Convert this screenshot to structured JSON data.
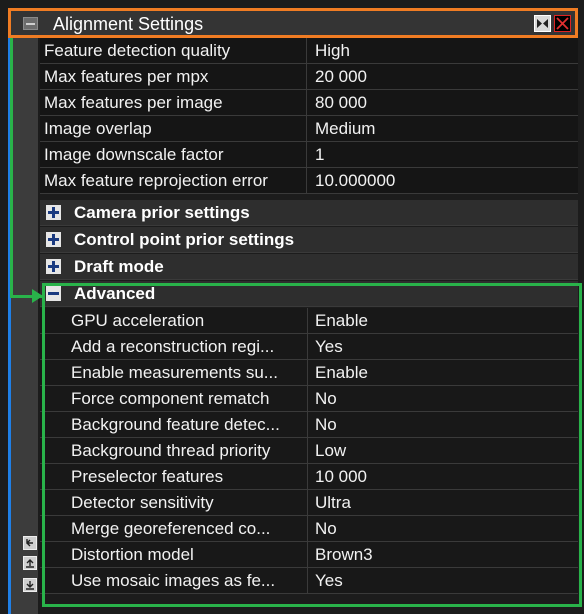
{
  "title_bar": {
    "title": "Alignment Settings"
  },
  "rows": [
    {
      "name": "Feature detection quality",
      "value": "High"
    },
    {
      "name": "Max features per mpx",
      "value": "20 000"
    },
    {
      "name": "Max features per image",
      "value": "80 000"
    },
    {
      "name": "Image overlap",
      "value": "Medium"
    },
    {
      "name": "Image downscale factor",
      "value": "1"
    },
    {
      "name": "Max feature reprojection error",
      "value": "10.000000"
    }
  ],
  "groups": [
    {
      "label": "Camera prior settings",
      "expanded": false
    },
    {
      "label": "Control point prior settings",
      "expanded": false
    },
    {
      "label": "Draft mode",
      "expanded": false
    },
    {
      "label": "Advanced",
      "expanded": true
    }
  ],
  "advanced_rows": [
    {
      "name": "GPU acceleration",
      "value": "Enable"
    },
    {
      "name": "Add a reconstruction regi...",
      "value": "Yes"
    },
    {
      "name": "Enable measurements su...",
      "value": "Enable"
    },
    {
      "name": "Force component rematch",
      "value": "No"
    },
    {
      "name": "Background feature detec...",
      "value": "No"
    },
    {
      "name": "Background thread priority",
      "value": "Low"
    },
    {
      "name": "Preselector features",
      "value": "10 000"
    },
    {
      "name": "Detector sensitivity",
      "value": "Ultra"
    },
    {
      "name": "Merge georeferenced co...",
      "value": "No"
    },
    {
      "name": "Distortion model",
      "value": "Brown3"
    },
    {
      "name": "Use mosaic images as fe...",
      "value": "Yes"
    }
  ],
  "colors": {
    "highlight_title": "#f07c23",
    "highlight_advanced": "#29b34a",
    "panel_edge": "#1f7fe6"
  }
}
